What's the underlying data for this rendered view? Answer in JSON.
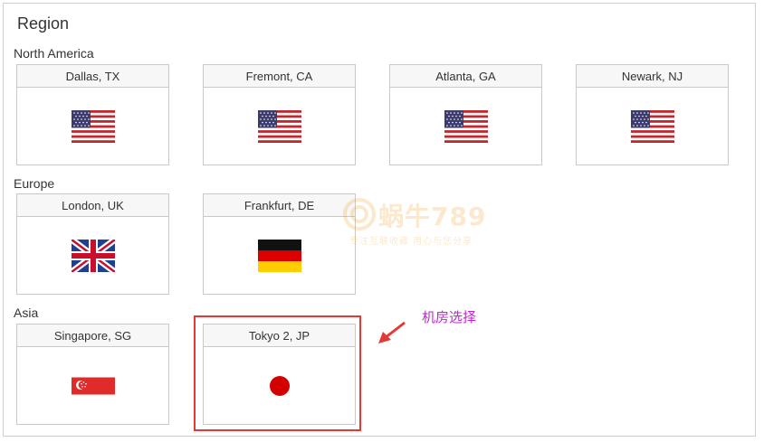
{
  "region": {
    "title": "Region",
    "groups": [
      {
        "label": "North America",
        "locations": [
          {
            "name": "Dallas, TX",
            "flag": "us-flag-icon"
          },
          {
            "name": "Fremont, CA",
            "flag": "us-flag-icon"
          },
          {
            "name": "Atlanta, GA",
            "flag": "us-flag-icon"
          },
          {
            "name": "Newark, NJ",
            "flag": "us-flag-icon"
          }
        ]
      },
      {
        "label": "Europe",
        "locations": [
          {
            "name": "London, UK",
            "flag": "uk-flag-icon"
          },
          {
            "name": "Frankfurt, DE",
            "flag": "de-flag-icon"
          }
        ]
      },
      {
        "label": "Asia",
        "locations": [
          {
            "name": "Singapore, SG",
            "flag": "sg-flag-icon"
          },
          {
            "name": "Tokyo 2, JP",
            "flag": "jp-flag-icon",
            "highlighted": true
          }
        ]
      }
    ]
  },
  "annotation": {
    "text": "机房选择",
    "color": "#c026d3",
    "highlight_color": "#e53935"
  },
  "watermark": {
    "main": "蜗牛789",
    "sub": "专注互联收藏   用心与您分享"
  }
}
